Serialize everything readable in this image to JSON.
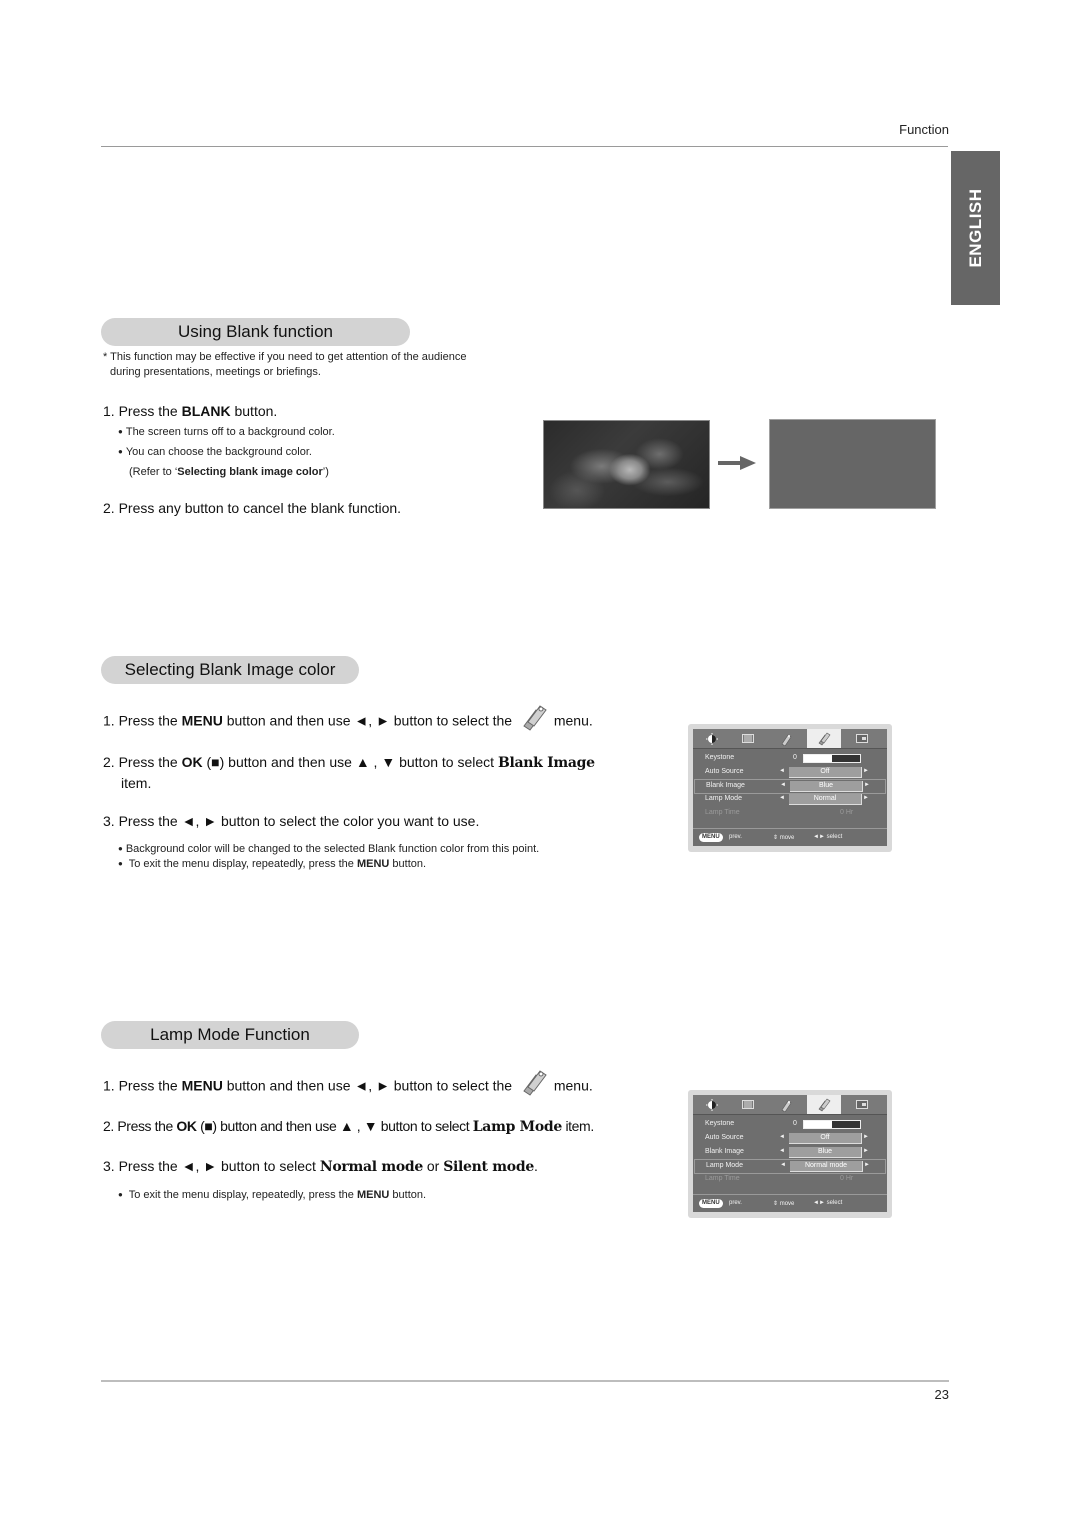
{
  "header": {
    "section": "Function",
    "language_tab": "ENGLISH",
    "page_number": "23"
  },
  "blank": {
    "title": "Using Blank function",
    "note_line1": "* This function may be effective if you need to get attention of the audience",
    "note_line2": "during presentations, meetings or briefings.",
    "step1_prefix": "1. Press the ",
    "step1_bold": "BLANK",
    "step1_suffix": " button.",
    "bullet1": "The screen turns off to a background color.",
    "bullet2": "You can choose the background color.",
    "refer_prefix": "(Refer to ‘",
    "refer_bold": "Selecting blank image color",
    "refer_suffix": "’)",
    "step2": "2. Press any button to cancel the blank function.",
    "illustration": {
      "before": "photo-of-flower",
      "after": "blank-gray-screen",
      "arrow": "right-arrow",
      "blank_color": "#666666"
    }
  },
  "blank_color": {
    "title": "Selecting Blank Image color",
    "step1": {
      "a": "1. Press the ",
      "b": "MENU",
      "c": " button and then use ◄, ► button to select the ",
      "d": " menu."
    },
    "step2": {
      "a": "2. Press the ",
      "b": "OK",
      "c": " (■) button and then use ▲ , ▼ button to select ",
      "d": "Blank Image",
      "e": "item."
    },
    "step3": "3. Press the ◄, ► button to select the color you want to use.",
    "bullet1": "Background color will be changed to the selected Blank function color from this point.",
    "bullet2": {
      "a": "To exit the menu display, repeatedly, press the ",
      "b": "MENU",
      "c": " button."
    }
  },
  "lamp": {
    "title": "Lamp Mode Function",
    "step1": {
      "a": "1. Press the ",
      "b": "MENU",
      "c": " button and then use ◄, ► button to select the ",
      "d": " menu."
    },
    "step2": {
      "a": "2. Press the ",
      "b": "OK",
      "c": " (■) button and then use ▲ , ▼ button to select ",
      "d": "Lamp Mode",
      "e": " item."
    },
    "step3": {
      "a": "3. Press the ◄, ► button to select ",
      "b": "Normal mode",
      "c": " or ",
      "d": "Silent mode",
      "e": "."
    },
    "bullet1": {
      "a": "To exit the menu display, repeatedly, press the ",
      "b": "MENU",
      "c": " button."
    }
  },
  "osd_menus": [
    {
      "tabs": [
        "picture-brightness-icon",
        "screen-adjust-icon",
        "tag-icon",
        "special-tags-icon",
        "input-source-icon"
      ],
      "active_tab": 3,
      "rows": [
        {
          "label": "Keystone",
          "value": "0",
          "slider_fraction": 0.5
        },
        {
          "label": "Auto Source",
          "value": "Off"
        },
        {
          "label": "Blank Image",
          "value": "Blue",
          "selected": true
        },
        {
          "label": "Lamp Mode",
          "value": "Normal"
        },
        {
          "label": "Lamp Time",
          "value": "0 Hr",
          "disabled": true
        }
      ],
      "footer": {
        "menu_key": "MENU",
        "prev": "prev.",
        "move": "move",
        "select": "select"
      }
    },
    {
      "tabs": [
        "picture-brightness-icon",
        "screen-adjust-icon",
        "tag-icon",
        "special-tags-icon",
        "input-source-icon"
      ],
      "active_tab": 3,
      "rows": [
        {
          "label": "Keystone",
          "value": "0",
          "slider_fraction": 0.5
        },
        {
          "label": "Auto Source",
          "value": "Off"
        },
        {
          "label": "Blank Image",
          "value": "Blue"
        },
        {
          "label": "Lamp Mode",
          "value": "Normal mode",
          "selected": true
        },
        {
          "label": "Lamp Time",
          "value": "0 Hr",
          "disabled": true
        }
      ],
      "footer": {
        "menu_key": "MENU",
        "prev": "prev.",
        "move": "move",
        "select": "select"
      }
    }
  ]
}
